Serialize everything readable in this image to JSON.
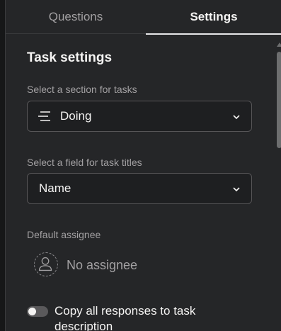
{
  "tabs": [
    {
      "label": "Questions",
      "active": false
    },
    {
      "label": "Settings",
      "active": true
    }
  ],
  "task_settings": {
    "heading": "Task settings",
    "section_label": "Select a section for tasks",
    "section_value": "Doing",
    "section_icon": "section-lines-icon",
    "title_field_label": "Select a field for task titles",
    "title_field_value": "Name",
    "assignee_label": "Default assignee",
    "assignee_value": "No assignee",
    "assignee_icon": "person-icon",
    "copy_responses_label": "Copy all responses to task description",
    "copy_responses_enabled": false
  },
  "colors": {
    "background": "#252628",
    "text_primary": "#f5f4f3",
    "text_secondary": "#a2a0a2",
    "field_border": "#565557"
  }
}
